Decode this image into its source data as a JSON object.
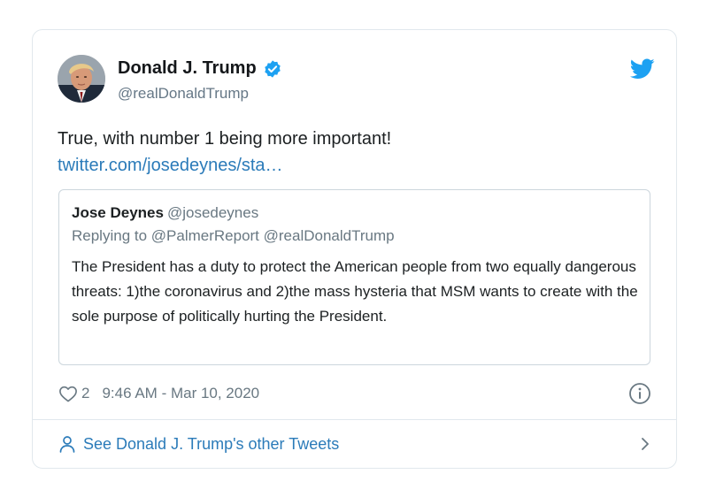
{
  "tweet": {
    "author_name": "Donald J. Trump",
    "author_handle": "@realDonaldTrump",
    "text": "True, with number 1 being more important!",
    "link": "twitter.com/josedeynes/sta…",
    "likes": "2",
    "timestamp": "9:46 AM - Mar 10, 2020"
  },
  "quote": {
    "author_name": "Jose Deynes",
    "author_handle": "@josedeynes",
    "replying_to": "Replying to @PalmerReport @realDonaldTrump",
    "text": "The President has a duty to protect the American people from two equally dangerous threats: 1)the coronavirus and 2)the mass hysteria that MSM wants to create with the sole purpose of politically hurting the President."
  },
  "footer": {
    "label": "See Donald J. Trump's other Tweets"
  },
  "icons": {
    "verified": "verified-badge-icon",
    "brand": "twitter-bird-icon",
    "like": "heart-icon",
    "info": "info-icon",
    "person": "person-icon",
    "chevron": "chevron-right-icon"
  },
  "colors": {
    "accent": "#1da1f2",
    "link": "#2b7bb9",
    "muted": "#697882",
    "border": "#e1e8ed"
  }
}
